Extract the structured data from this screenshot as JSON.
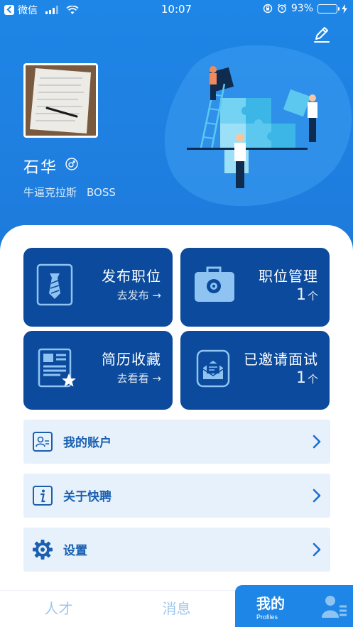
{
  "status_bar": {
    "carrier": "微信",
    "time": "10:07",
    "battery_pct": "93%",
    "battery_level": 0.93
  },
  "profile": {
    "name": "石华",
    "company": "牛逼克拉斯",
    "role": "BOSS"
  },
  "cards": [
    {
      "title": "发布职位",
      "sub": "去发布",
      "icon": "necktie-icon"
    },
    {
      "title": "职位管理",
      "count": "1",
      "unit": "个",
      "icon": "briefcase-icon"
    },
    {
      "title": "简历收藏",
      "sub": "去看看",
      "icon": "resume-star-icon"
    },
    {
      "title": "已邀请面试",
      "count": "1",
      "unit": "个",
      "icon": "invitation-mail-icon"
    }
  ],
  "menu": [
    {
      "label": "我的账户",
      "icon": "account-card-icon"
    },
    {
      "label": "关于快聘",
      "icon": "info-icon"
    },
    {
      "label": "设置",
      "icon": "gear-icon"
    }
  ],
  "tabs": [
    {
      "label": "人才"
    },
    {
      "label": "消息"
    },
    {
      "label": "我的",
      "sub": "Profiles",
      "active": true
    }
  ],
  "colors": {
    "primary": "#1e86e6",
    "card_bg": "#0b4a9c",
    "list_bg": "#e6f1fb",
    "list_text": "#1a5fb0",
    "tab_inactive": "#9dc6ef"
  }
}
